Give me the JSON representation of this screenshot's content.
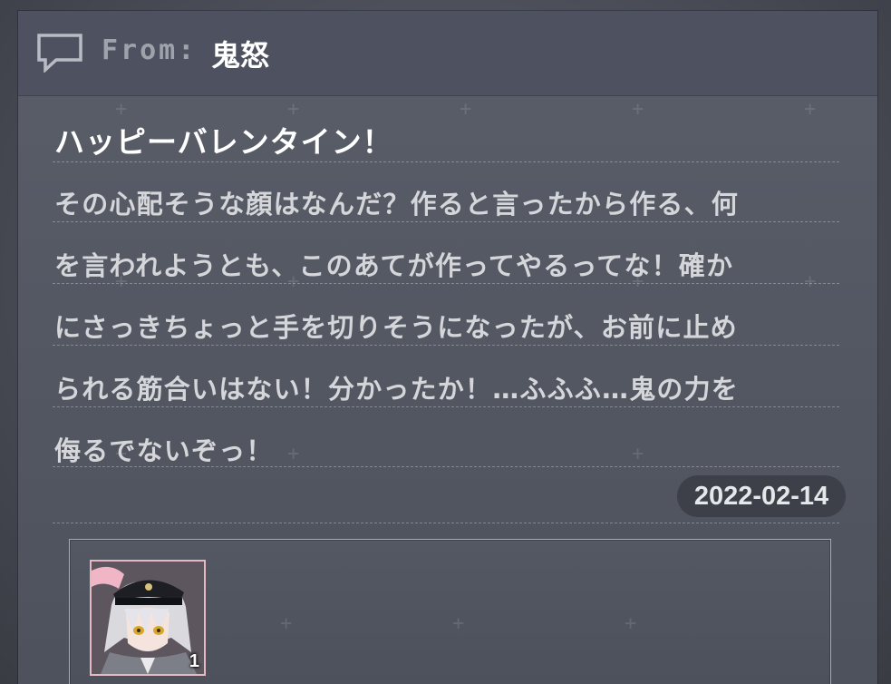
{
  "header": {
    "from_label": "From:",
    "sender": "鬼怒",
    "icon": "chat-bubble-icon"
  },
  "message": {
    "title": "ハッピーバレンタイン！",
    "lines": [
      "その心配そうな顔はなんだ？作ると言ったから作る、何",
      "を言われようとも、このあてが作ってやるってな！確か",
      "にさっきちょっと手を切りそうになったが、お前に止め",
      "られる筋合いはない！分かったか！…ふふふ…鬼の力を",
      "侮るでないぞっ！"
    ],
    "date": "2022-02-14"
  },
  "attachment": {
    "item_icon": "character-portrait-icon",
    "count": "1"
  },
  "colors": {
    "panel": "#545863",
    "header": "#4e5260",
    "title_text": "#ffffff",
    "body_text": "#d5d6da",
    "date_badge": "#3d4048",
    "slot_border": "#e6b9c2"
  }
}
